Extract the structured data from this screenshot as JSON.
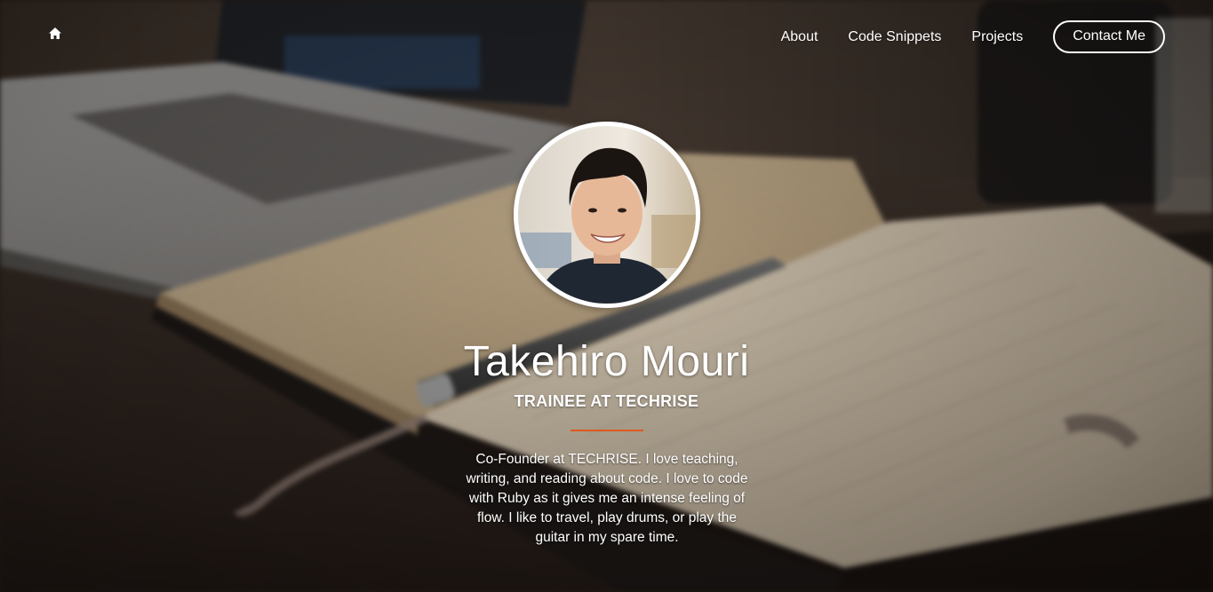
{
  "nav": {
    "home_icon": "home-icon",
    "links": [
      "About",
      "Code Snippets",
      "Projects"
    ],
    "contact_label": "Contact Me"
  },
  "profile": {
    "name": "Takehiro Mouri",
    "role": "TRAINEE AT TECHRISE",
    "bio": "Co-Founder at TECHRISE. I love teaching, writing, and reading about code. I love to code with Ruby as it gives me an intense feeling of flow. I like to travel, play drums, or play the guitar in my spare time."
  },
  "colors": {
    "accent": "#e1581d",
    "text": "#ffffff"
  }
}
